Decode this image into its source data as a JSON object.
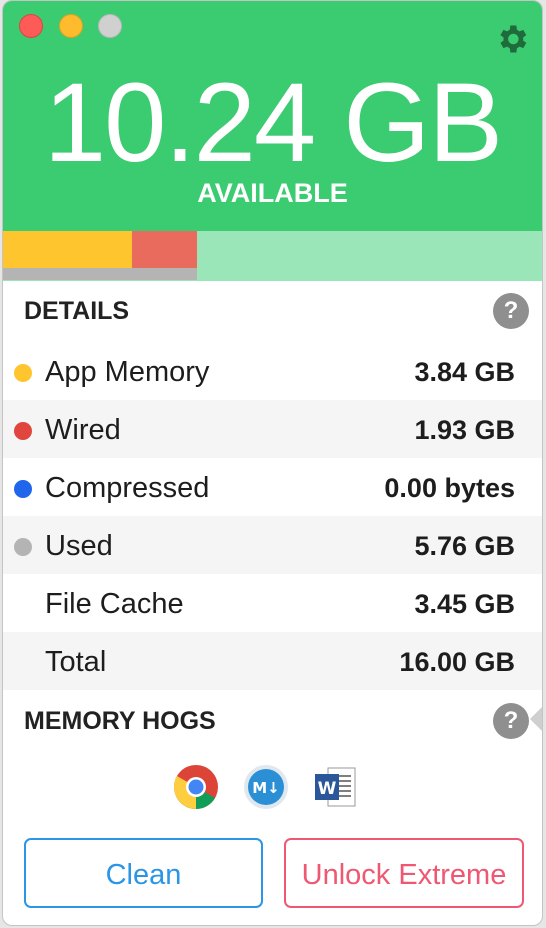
{
  "header": {
    "available_value": "10.24 GB",
    "available_label": "AVAILABLE",
    "color": "#3bcb71"
  },
  "memory_bar": {
    "app_memory_fraction": 0.24,
    "wired_fraction": 0.12,
    "used_fraction": 0.36,
    "colors": {
      "app_memory": "#fec52e",
      "wired": "#e96b5e",
      "used": "#b4b4b4",
      "free": "#9ae6b9"
    }
  },
  "details": {
    "title": "DETAILS",
    "help_label": "?",
    "rows": [
      {
        "label": "App Memory",
        "value": "3.84 GB",
        "dot_color": "#fec52e"
      },
      {
        "label": "Wired",
        "value": "1.93 GB",
        "dot_color": "#e0463d"
      },
      {
        "label": "Compressed",
        "value": "0.00 bytes",
        "dot_color": "#1f66ed"
      },
      {
        "label": "Used",
        "value": "5.76 GB",
        "dot_color": "#b4b4b4"
      },
      {
        "label": "File Cache",
        "value": "3.45 GB",
        "dot_color": ""
      },
      {
        "label": "Total",
        "value": "16.00 GB",
        "dot_color": ""
      }
    ]
  },
  "memory_hogs": {
    "title": "MEMORY HOGS",
    "help_label": "?",
    "apps": [
      {
        "icon": "chrome-icon"
      },
      {
        "icon": "markdown-editor-icon",
        "badge": "M↓"
      },
      {
        "icon": "microsoft-word-icon",
        "badge": "W"
      }
    ]
  },
  "buttons": {
    "clean_label": "Clean",
    "unlock_label": "Unlock Extreme"
  }
}
